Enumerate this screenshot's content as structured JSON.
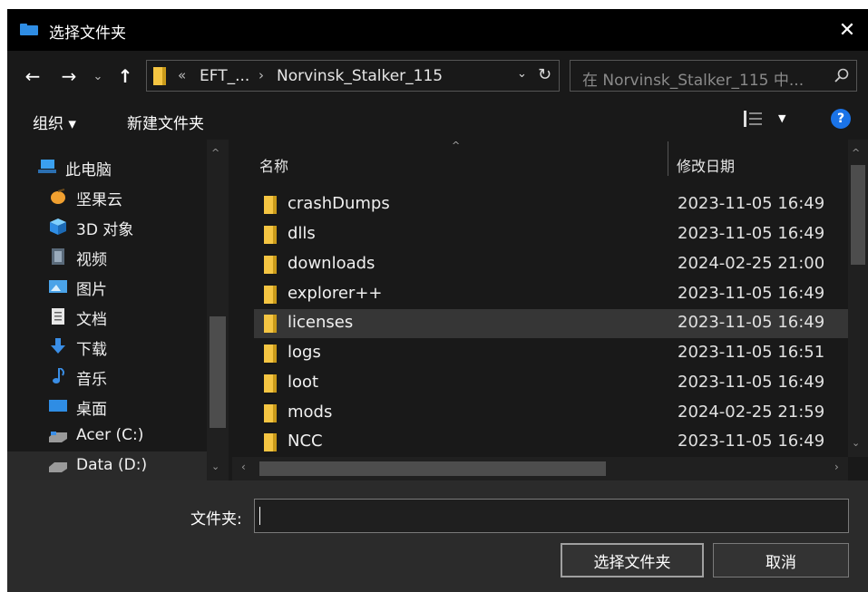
{
  "window": {
    "title": "选择文件夹",
    "close_glyph": "✕"
  },
  "navigation": {
    "back": "←",
    "forward": "→",
    "recent": "⌄",
    "up": "↑"
  },
  "address_bar": {
    "overflow": "«",
    "breadcrumbs": [
      "EFT_...",
      "Norvinsk_Stalker_115"
    ],
    "separator": "›",
    "dropdown_glyph": "⌄",
    "refresh_glyph": "↻"
  },
  "search": {
    "placeholder": "在 Norvinsk_Stalker_115 中..."
  },
  "toolbar": {
    "organize": "组织 ▾",
    "new_folder": "新建文件夹",
    "help": "?"
  },
  "sidebar": {
    "items": [
      {
        "label": "此电脑",
        "icon": "computer-icon"
      },
      {
        "label": "坚果云",
        "icon": "nutstore-icon"
      },
      {
        "label": "3D 对象",
        "icon": "cube-icon"
      },
      {
        "label": "视频",
        "icon": "video-icon"
      },
      {
        "label": "图片",
        "icon": "image-icon"
      },
      {
        "label": "文档",
        "icon": "document-icon"
      },
      {
        "label": "下载",
        "icon": "download-icon"
      },
      {
        "label": "音乐",
        "icon": "music-icon"
      },
      {
        "label": "桌面",
        "icon": "desktop-icon"
      },
      {
        "label": "Acer (C:)",
        "icon": "drive-icon"
      },
      {
        "label": "Data (D:)",
        "icon": "drive-icon"
      }
    ]
  },
  "file_list": {
    "columns": {
      "name": "名称",
      "date": "修改日期"
    },
    "rows": [
      {
        "name": "crashDumps",
        "date": "2023-11-05 16:49"
      },
      {
        "name": "dlls",
        "date": "2023-11-05 16:49"
      },
      {
        "name": "downloads",
        "date": "2024-02-25 21:00"
      },
      {
        "name": "explorer++",
        "date": "2023-11-05 16:49"
      },
      {
        "name": "licenses",
        "date": "2023-11-05 16:49"
      },
      {
        "name": "logs",
        "date": "2023-11-05 16:51"
      },
      {
        "name": "loot",
        "date": "2023-11-05 16:49"
      },
      {
        "name": "mods",
        "date": "2024-02-25 21:59"
      },
      {
        "name": "NCC",
        "date": "2023-11-05 16:49"
      }
    ],
    "selected_index": 4
  },
  "footer": {
    "folder_label": "文件夹:",
    "folder_value": "",
    "select_button": "选择文件夹",
    "cancel_button": "取消"
  },
  "colors": {
    "dialog_bg": "#191919",
    "titlebar_bg": "#000000",
    "folder_yellow": "#f5c542",
    "selection_bg": "#363636",
    "help_blue": "#1a73e8"
  }
}
